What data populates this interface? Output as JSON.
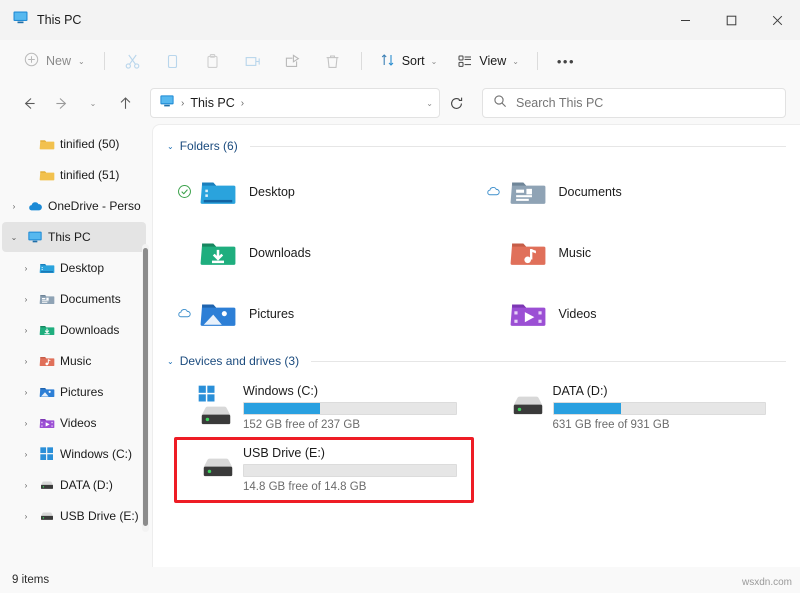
{
  "window": {
    "title": "This PC",
    "title_icon": "this-pc-monitor-icon",
    "controls": {
      "minimize": "─",
      "maximize": "☐",
      "close": "✕"
    }
  },
  "toolbar": {
    "new_label": "New",
    "new_icon": "plus-circle-icon",
    "cut_icon": "scissors-icon",
    "copy_icon": "copy-icon",
    "paste_icon": "paste-icon",
    "rename_icon": "rename-icon",
    "share_icon": "share-icon",
    "delete_icon": "trash-icon",
    "sort_label": "Sort",
    "sort_icon": "sort-arrows-icon",
    "view_label": "View",
    "view_icon": "view-list-icon",
    "overflow_label": "•••",
    "chevron": "⌄"
  },
  "addressbar": {
    "back_icon": "←",
    "forward_icon": "→",
    "recent_icon": "⌄",
    "up_icon": "↑",
    "path_icon": "this-pc-monitor-icon",
    "crumbs": [
      "This PC"
    ],
    "crumb_sep": "›",
    "dropdown_icon": "⌄",
    "refresh_icon": "↻",
    "search_icon": "search-icon",
    "search_placeholder": "Search This PC"
  },
  "sidebar": {
    "items": [
      {
        "label": "tinified (50)",
        "icon": "folder-yellow-icon",
        "twisty": "",
        "indent": true,
        "selected": false
      },
      {
        "label": "tinified (51)",
        "icon": "folder-yellow-icon",
        "twisty": "",
        "indent": true,
        "selected": false
      },
      {
        "label": "OneDrive - Perso",
        "icon": "onedrive-cloud-icon",
        "twisty": "›",
        "indent": false,
        "selected": false
      },
      {
        "label": "This PC",
        "icon": "this-pc-monitor-icon",
        "twisty": "⌄",
        "indent": false,
        "selected": true
      },
      {
        "label": "Desktop",
        "icon": "desktop-folder-icon",
        "twisty": "›",
        "indent": true,
        "selected": false
      },
      {
        "label": "Documents",
        "icon": "documents-folder-icon",
        "twisty": "›",
        "indent": true,
        "selected": false
      },
      {
        "label": "Downloads",
        "icon": "downloads-icon",
        "twisty": "›",
        "indent": true,
        "selected": false
      },
      {
        "label": "Music",
        "icon": "music-icon",
        "twisty": "›",
        "indent": true,
        "selected": false
      },
      {
        "label": "Pictures",
        "icon": "pictures-icon",
        "twisty": "›",
        "indent": true,
        "selected": false
      },
      {
        "label": "Videos",
        "icon": "videos-icon",
        "twisty": "›",
        "indent": true,
        "selected": false
      },
      {
        "label": "Windows (C:)",
        "icon": "windows-drive-icon",
        "twisty": "›",
        "indent": true,
        "selected": false
      },
      {
        "label": "DATA (D:)",
        "icon": "drive-icon",
        "twisty": "›",
        "indent": true,
        "selected": false
      },
      {
        "label": "USB Drive (E:)",
        "icon": "drive-icon",
        "twisty": "›",
        "indent": true,
        "selected": false
      }
    ]
  },
  "main": {
    "folders_group": {
      "title": "Folders (6)",
      "chevron": "⌄",
      "items": [
        {
          "label": "Desktop",
          "icon": "desktop-folder-icon",
          "status": "synced-check-icon"
        },
        {
          "label": "Documents",
          "icon": "documents-folder-icon",
          "status": "cloud-icon"
        },
        {
          "label": "Downloads",
          "icon": "downloads-folder-icon",
          "status": ""
        },
        {
          "label": "Music",
          "icon": "music-folder-icon",
          "status": ""
        },
        {
          "label": "Pictures",
          "icon": "pictures-folder-icon",
          "status": "cloud-icon"
        },
        {
          "label": "Videos",
          "icon": "videos-folder-icon",
          "status": ""
        }
      ]
    },
    "drives_group": {
      "title": "Devices and drives (3)",
      "chevron": "⌄",
      "items": [
        {
          "label": "Windows (C:)",
          "icon": "windows-drive-icon",
          "free_text": "152 GB free of 237 GB",
          "used_percent": 36
        },
        {
          "label": "DATA (D:)",
          "icon": "drive-icon",
          "free_text": "631 GB free of 931 GB",
          "used_percent": 32
        },
        {
          "label": "USB Drive (E:)",
          "icon": "drive-icon",
          "free_text": "14.8 GB free of 14.8 GB",
          "used_percent": 0
        }
      ]
    },
    "annotation": {
      "shape": "red-rectangle",
      "color": "#ee1c25",
      "targets": "USB Drive (E:)"
    }
  },
  "statusbar": {
    "items_count": "9 items"
  },
  "watermark": {
    "text": "wsxdn.com"
  },
  "colors": {
    "accent_blue": "#29a0e0",
    "group_header": "#1b4b7e",
    "annotation_red": "#ee1c25"
  }
}
